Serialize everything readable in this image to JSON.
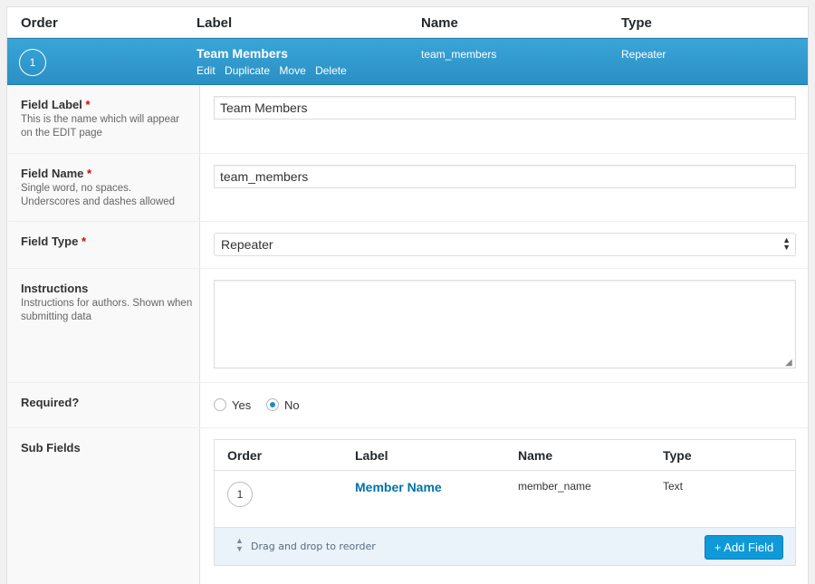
{
  "header": {
    "order": "Order",
    "label": "Label",
    "name": "Name",
    "type": "Type"
  },
  "field": {
    "order": "1",
    "label": "Team Members",
    "name": "team_members",
    "type": "Repeater",
    "actions": [
      "Edit",
      "Duplicate",
      "Move",
      "Delete"
    ]
  },
  "settings": {
    "field_label": {
      "label": "Field Label",
      "required_mark": "*",
      "description": "This is the name which will appear on the EDIT page",
      "value": "Team Members"
    },
    "field_name": {
      "label": "Field Name",
      "required_mark": "*",
      "description": "Single word, no spaces. Underscores and dashes allowed",
      "value": "team_members"
    },
    "field_type": {
      "label": "Field Type",
      "required_mark": "*",
      "value": "Repeater"
    },
    "instructions": {
      "label": "Instructions",
      "description": "Instructions for authors. Shown when submitting data",
      "value": ""
    },
    "required": {
      "label": "Required?",
      "options": [
        "Yes",
        "No"
      ],
      "selected": "No"
    },
    "sub_fields": {
      "label": "Sub Fields",
      "header": {
        "order": "Order",
        "label": "Label",
        "name": "Name",
        "type": "Type"
      },
      "rows": [
        {
          "order": "1",
          "label": "Member Name",
          "name": "member_name",
          "type": "Text"
        }
      ],
      "drag_hint": "Drag and drop to reorder",
      "add_button": "+ Add Field"
    }
  },
  "colors": {
    "accent": "#2a8fc4",
    "link": "#0073aa",
    "button": "#0e9ad8",
    "required": "#dd0000"
  }
}
